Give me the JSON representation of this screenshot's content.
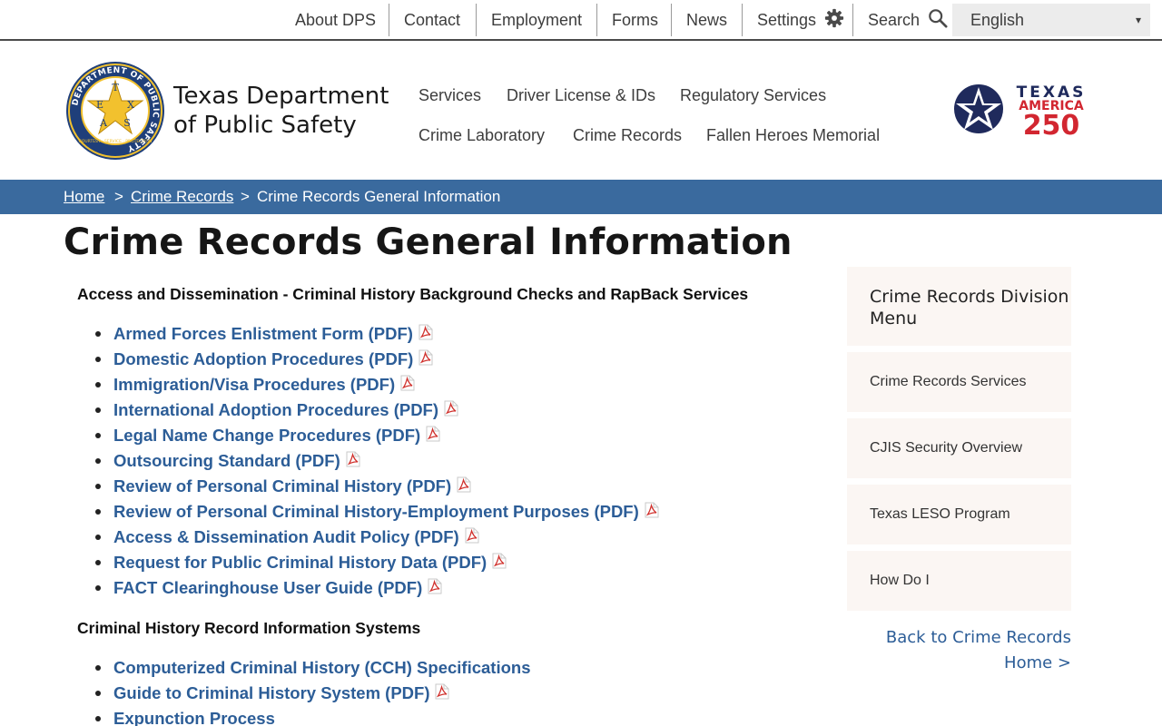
{
  "utility_nav": {
    "links": [
      {
        "label": "About DPS"
      },
      {
        "label": "Contact"
      },
      {
        "label": "Employment"
      },
      {
        "label": "Forms"
      },
      {
        "label": "News"
      },
      {
        "label": "Settings",
        "icon": "gear-icon"
      },
      {
        "label": "Search",
        "icon": "search-icon"
      }
    ],
    "language": {
      "selected": "English"
    }
  },
  "header": {
    "title_line1": "Texas Department",
    "title_line2": "of Public Safety",
    "seal": {
      "ring_text": "DEPARTMENT OF PUBLIC SAFETY",
      "letters": [
        "T",
        "E",
        "X",
        "A",
        "S"
      ],
      "motto": "COURTESY · SERVICE · PROTECTION"
    },
    "main_nav": [
      {
        "label": "Services"
      },
      {
        "label": "Driver License & IDs"
      },
      {
        "label": "Regulatory Services"
      },
      {
        "label": "Crime Laboratory"
      },
      {
        "label": "Crime Records"
      },
      {
        "label": "Fallen Heroes Memorial"
      }
    ],
    "texas250": {
      "line1": "TEXAS",
      "line2": "AMERICA",
      "line3": "250"
    }
  },
  "breadcrumb": {
    "items": [
      "Home",
      "Crime Records",
      "Crime Records General Information"
    ],
    "separator": ">"
  },
  "main": {
    "title": "Crime Records General Information",
    "sections": [
      {
        "heading": "Access and Dissemination - Criminal History Background Checks and RapBack Services",
        "items": [
          {
            "label": "Armed Forces Enlistment Form (PDF)",
            "pdf": true
          },
          {
            "label": "Domestic Adoption Procedures (PDF)",
            "pdf": true
          },
          {
            "label": "Immigration/Visa Procedures (PDF)",
            "pdf": true
          },
          {
            "label": "International Adoption Procedures (PDF)",
            "pdf": true
          },
          {
            "label": "Legal Name Change Procedures (PDF)",
            "pdf": true
          },
          {
            "label": "Outsourcing Standard (PDF)",
            "pdf": true
          },
          {
            "label": "Review of Personal Criminal History (PDF)",
            "pdf": true
          },
          {
            "label": "Review of Personal Criminal History-Employment Purposes (PDF)",
            "pdf": true
          },
          {
            "label": "Access & Dissemination Audit Policy (PDF)",
            "pdf": true
          },
          {
            "label": "Request for Public Criminal History Data (PDF)",
            "pdf": true
          },
          {
            "label": "FACT Clearinghouse User Guide (PDF)",
            "pdf": true
          }
        ]
      },
      {
        "heading": "Criminal History Record Information Systems",
        "items": [
          {
            "label": "Computerized Criminal History (CCH) Specifications",
            "pdf": false
          },
          {
            "label": "Guide to Criminal History System (PDF)",
            "pdf": true
          },
          {
            "label": "Expunction Process",
            "pdf": false
          }
        ]
      }
    ]
  },
  "sidebar": {
    "title": "Crime Records Division Menu",
    "items": [
      {
        "label": "Crime Records Services"
      },
      {
        "label": "CJIS Security Overview"
      },
      {
        "label": "Texas LESO Program"
      },
      {
        "label": "How Do I"
      }
    ],
    "back_link": "Back to Crime Records Home >"
  },
  "colors": {
    "breadcrumb_bg": "#3a6a9e",
    "link": "#2c5d97",
    "sidebar_bg": "#fbf6f3",
    "pdf_red": "#d0312d",
    "seal_blue": "#1f3f7a",
    "seal_gold": "#f2c12e",
    "t250_navy": "#1f2a5c",
    "t250_red": "#d22630"
  }
}
